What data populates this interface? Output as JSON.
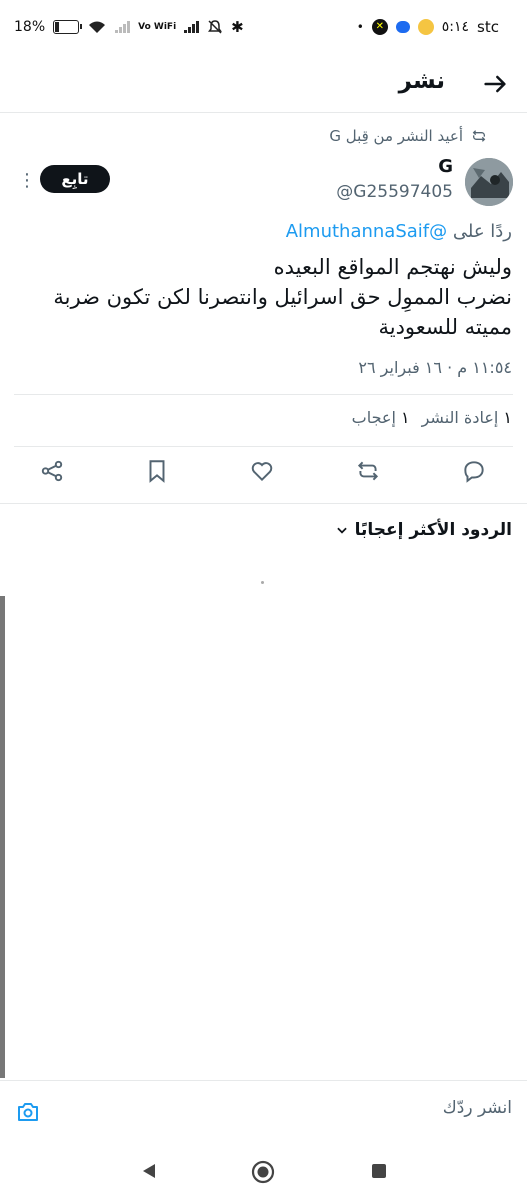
{
  "status_bar": {
    "battery": "18%",
    "wifi_label": "Vo WiFi",
    "time": "٥:١٤",
    "carrier": "stc"
  },
  "header": {
    "title": "نشر"
  },
  "repost_notice": "أعيد النشر من قِبل G",
  "author": {
    "name": "G",
    "handle": "@G25597405"
  },
  "follow_button": "تابِع",
  "reply_to": {
    "prefix": "ردًا على",
    "mention": "@AlmuthannaSaif"
  },
  "post_text": [
    "وليش نهتجم المواقع البعيده",
    "نضرب المموِل حق اسرائيل وانتصرنا لكن تكون ضربة",
    "مميته للسعودية"
  ],
  "timestamp": "١١:٥٤ م · ١٦ فبراير ٢٦",
  "stats": {
    "reposts_count": "١",
    "reposts_label": "إعادة النشر",
    "likes_count": "١",
    "likes_label": "إعجاب"
  },
  "sort_label": "الردود الأكثر إعجابًا",
  "composer": {
    "placeholder": "انشر ردّك"
  },
  "icons": [
    "back-arrow-icon",
    "repost-icon",
    "reply-icon",
    "retweet-icon",
    "like-icon",
    "bookmark-icon",
    "share-icon",
    "camera-icon",
    "chevron-down-icon"
  ],
  "colors": {
    "accent": "#1d9bf0",
    "text": "#0f1419",
    "muted": "#536471",
    "follow_bg": "#0f1419"
  }
}
